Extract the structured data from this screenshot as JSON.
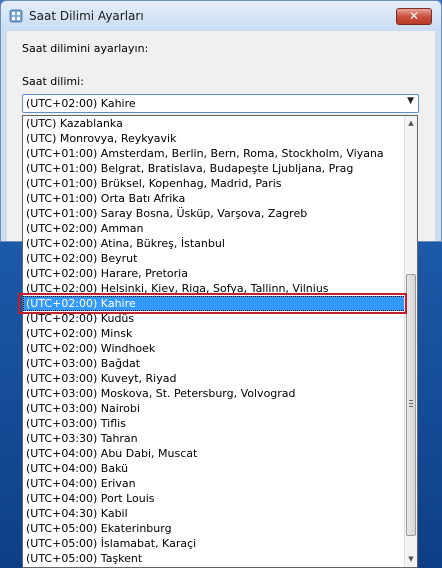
{
  "window": {
    "title": "Saat Dilimi Ayarları",
    "close_glyph": "✕"
  },
  "form": {
    "instruction": "Saat dilimini ayarlayın:",
    "timezone_label": "Saat dilimi:",
    "timezone_value": "(UTC+02:00) Kahire",
    "arrow_glyph": "▼"
  },
  "dropdown": {
    "items": [
      "(UTC) Kazablanka",
      "(UTC) Monrovya, Reykyavik",
      "(UTC+01:00) Amsterdam, Berlin, Bern, Roma, Stockholm, Viyana",
      "(UTC+01:00) Belgrat, Bratislava, Budapeşte Ljubljana, Prag",
      "(UTC+01:00) Brüksel, Kopenhag, Madrid, Paris",
      "(UTC+01:00) Orta Batı Afrika",
      "(UTC+01:00) Saray Bosna, Üsküp, Varşova, Zagreb",
      "(UTC+02:00) Amman",
      "(UTC+02:00) Atina, Bükreş, İstanbul",
      "(UTC+02:00) Beyrut",
      "(UTC+02:00) Harare, Pretoria",
      "(UTC+02:00) Helsinki, Kiev, Riga, Sofya, Tallinn, Vilnius",
      "(UTC+02:00) Kahire",
      "(UTC+02:00) Kudüs",
      "(UTC+02:00) Minsk",
      "(UTC+02:00) Windhoek",
      "(UTC+03:00) Bağdat",
      "(UTC+03:00) Kuveyt, Riyad",
      "(UTC+03:00) Moskova, St. Petersburg, Volvograd",
      "(UTC+03:00) Nairobi",
      "(UTC+03:00) Tiflis",
      "(UTC+03:30) Tahran",
      "(UTC+04:00) Abu Dabi, Muscat",
      "(UTC+04:00) Bakü",
      "(UTC+04:00) Erivan",
      "(UTC+04:00) Port Louis",
      "(UTC+04:30) Kabil",
      "(UTC+05:00) Ekaterinburg",
      "(UTC+05:00) İslamabat, Karaçi",
      "(UTC+05:00) Taşkent"
    ],
    "selected_index": 12
  },
  "colors": {
    "selection": "#3399ff",
    "highlight_border": "#c0202b"
  }
}
